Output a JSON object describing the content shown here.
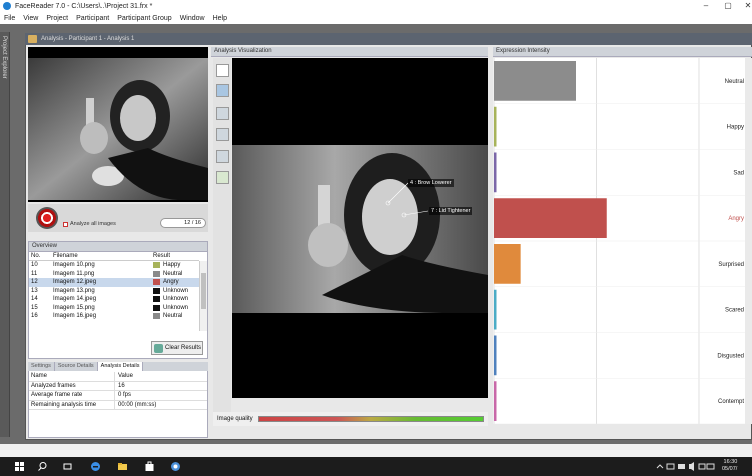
{
  "window": {
    "title": "FaceReader 7.0 - C:\\Users\\..\\Project 31.frx *"
  },
  "menu": [
    "File",
    "View",
    "Project",
    "Participant",
    "Participant Group",
    "Window",
    "Help"
  ],
  "sidebar": {
    "label": "Project Explorer"
  },
  "analysis_window": {
    "title": "Analysis - Participant 1 - Analysis 1"
  },
  "recorder": {
    "analyze_all_label": "Analyze all images",
    "frame_counter": "12 / 16"
  },
  "overview": {
    "title": "Overview",
    "columns": [
      "No.",
      "Filename",
      "Result"
    ],
    "rows": [
      {
        "no": "10",
        "file": "Imagem 10.png",
        "result": "Happy",
        "color": "#a7b35a"
      },
      {
        "no": "11",
        "file": "Imagem 11.png",
        "result": "Neutral",
        "color": "#8a8a8a"
      },
      {
        "no": "12",
        "file": "Imagem 12.jpeg",
        "result": "Angry",
        "color": "#c0504d",
        "selected": true
      },
      {
        "no": "13",
        "file": "Imagem 13.png",
        "result": "Unknown",
        "color": "#111111"
      },
      {
        "no": "14",
        "file": "Imagem 14.jpeg",
        "result": "Unknown",
        "color": "#111111"
      },
      {
        "no": "15",
        "file": "Imagem 15.png",
        "result": "Unknown",
        "color": "#111111"
      },
      {
        "no": "16",
        "file": "Imagem 16.jpeg",
        "result": "Neutral",
        "color": "#8a8a8a"
      }
    ],
    "clear_button": "Clear Results"
  },
  "details": {
    "tabs": [
      "Settings",
      "Source Details",
      "Analysis Details"
    ],
    "columns": [
      "Name",
      "Value"
    ],
    "rows": [
      {
        "name": "Analyzed frames",
        "value": "16"
      },
      {
        "name": "Average frame rate",
        "value": "0 fps"
      },
      {
        "name": "Remaining analysis time",
        "value": "00:00 (mm:ss)"
      }
    ]
  },
  "visualization": {
    "title": "Analysis Visualization",
    "annotations": [
      "4 : Brow Lowerer",
      "7 : Lid Tightener"
    ],
    "quality_label": "Image quality"
  },
  "expression": {
    "title": "Expression Intensity",
    "categories": [
      "Neutral",
      "Happy",
      "Sad",
      "Angry",
      "Surprised",
      "Scared",
      "Disgusted",
      "Contempt"
    ],
    "values": [
      0.4,
      0.01,
      0.01,
      0.55,
      0.13,
      0.01,
      0.01,
      0.01
    ],
    "colors": [
      "#8c8c8c",
      "#a7b35a",
      "#7b67a8",
      "#c0504d",
      "#e08a3c",
      "#4bacc6",
      "#4f81bd",
      "#c868a8"
    ],
    "highlight": "Angry"
  },
  "taskbar": {
    "time": "16:30",
    "date": "05/07/"
  }
}
